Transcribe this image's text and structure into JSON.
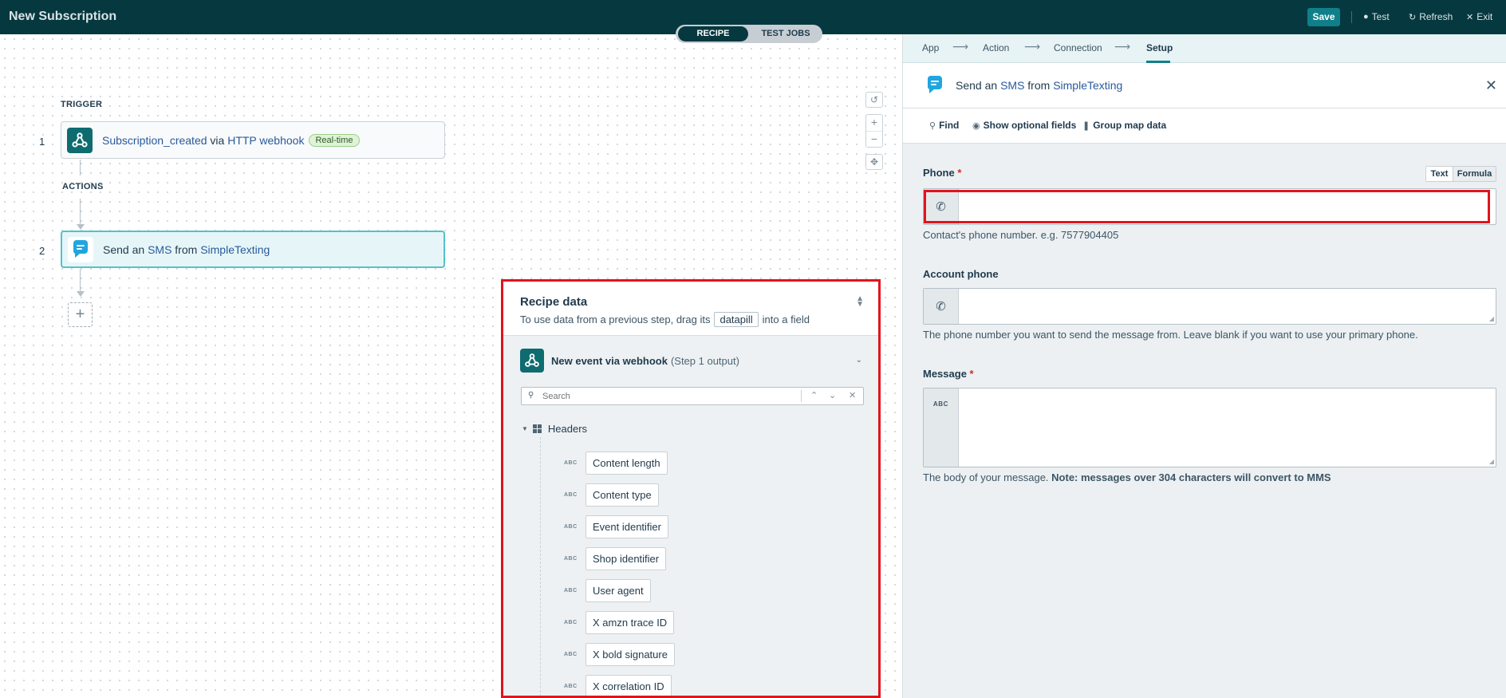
{
  "app": {
    "title": "New Subscription",
    "mode_tabs": [
      "RECIPE",
      "TEST JOBS"
    ],
    "save_label": "Save",
    "test_label": "Test",
    "refresh_label": "Refresh",
    "exit_label": "Exit"
  },
  "canvas": {
    "trigger_label": "TRIGGER",
    "actions_label": "ACTIONS",
    "steps": [
      {
        "number": "1",
        "event": "Subscription_created",
        "via": "via",
        "app": "HTTP webhook",
        "badge": "Real-time"
      },
      {
        "number": "2",
        "prefix": "Send an",
        "object": "SMS",
        "from": "from",
        "app": "SimpleTexting"
      }
    ],
    "add_symbol": "+"
  },
  "recipe_data": {
    "title": "Recipe data",
    "subtitle_before": "To use data from a previous step, drag its",
    "pill_word": "datapill",
    "subtitle_after": "into a field",
    "output_title": "New event via webhook",
    "output_note": "(Step 1 output)",
    "search_placeholder": "Search",
    "group_label": "Headers",
    "type_tag": "ABC",
    "pills": [
      "Content length",
      "Content type",
      "Event identifier",
      "Shop identifier",
      "User agent",
      "X amzn trace ID",
      "X bold signature",
      "X correlation ID"
    ]
  },
  "setup_panel": {
    "breadcrumb": [
      "App",
      "Action",
      "Connection",
      "Setup"
    ],
    "header_prefix": "Send an",
    "header_object": "SMS",
    "header_from": "from",
    "header_app": "SimpleTexting",
    "tools": [
      "Find",
      "Show optional fields",
      "Group map data"
    ],
    "mode_options": [
      "Text",
      "Formula"
    ],
    "fields": {
      "phone": {
        "label": "Phone",
        "required": "*",
        "value": "",
        "hint": "Contact's phone number. e.g. 7577904405"
      },
      "account_phone": {
        "label": "Account phone",
        "value": "",
        "hint": "The phone number you want to send the message from. Leave blank if you want to use your primary phone."
      },
      "message": {
        "label": "Message",
        "required": "*",
        "type_tag": "ABC",
        "value": "",
        "hint": "The body of your message.",
        "hint_bold": "Note: messages over 304 characters will convert to MMS"
      }
    }
  },
  "colors": {
    "topbar": "#06383f",
    "accent": "#0f8089",
    "highlight_box": "#e0141c"
  }
}
